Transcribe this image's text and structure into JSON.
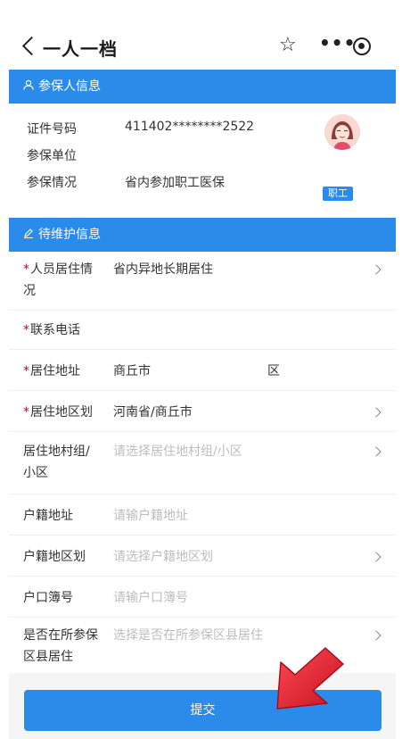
{
  "header": {
    "title": "一人一档"
  },
  "participant": {
    "section_title": "参保人信息",
    "rows": [
      {
        "label": "证件号码",
        "value": "411402********2522"
      },
      {
        "label": "参保单位",
        "value": ""
      },
      {
        "label": "参保情况",
        "value": "省内参加职工医保"
      }
    ],
    "badge": "职工"
  },
  "pending": {
    "section_title": "待维护信息",
    "fields": [
      {
        "label_line1": "人员居住情",
        "label_line2": "况",
        "required": "*",
        "value": "省内异地长期居住"
      },
      {
        "label_line1": "联系电话",
        "label_line2": "",
        "required": "*",
        "value": ""
      },
      {
        "label_line1": "居住地址",
        "label_line2": "",
        "required": "*",
        "value": "商丘市",
        "value2": "区"
      },
      {
        "label_line1": "居住地区划",
        "label_line2": "",
        "required": "*",
        "value": "河南省/商丘市"
      },
      {
        "label_line1": "居住地村组/",
        "label_line2": "小区",
        "required": "",
        "value": "请选择居住地村组/小区"
      },
      {
        "label_line1": "户籍地址",
        "label_line2": "",
        "required": "",
        "value": "请输户籍地址"
      },
      {
        "label_line1": "户籍地区划",
        "label_line2": "",
        "required": "",
        "value": "请选择户籍地区划"
      },
      {
        "label_line1": "户口簿号",
        "label_line2": "",
        "required": "",
        "value": "请输户口簿号"
      },
      {
        "label_line1": "是否在所参保",
        "label_line2": "区县居住",
        "required": "",
        "value": "选择是否在所参保区县居住"
      }
    ]
  },
  "submit_label": "提交",
  "colors": {
    "accent": "#2b8bea",
    "required": "#d0021b",
    "placeholder": "#bdbdbd",
    "arrow": "#e0202c"
  },
  "icons": [
    "back-icon",
    "star-icon",
    "more-icon",
    "target-icon",
    "user-icon",
    "edit-icon",
    "chevron-right-icon",
    "pointer-arrow"
  ]
}
